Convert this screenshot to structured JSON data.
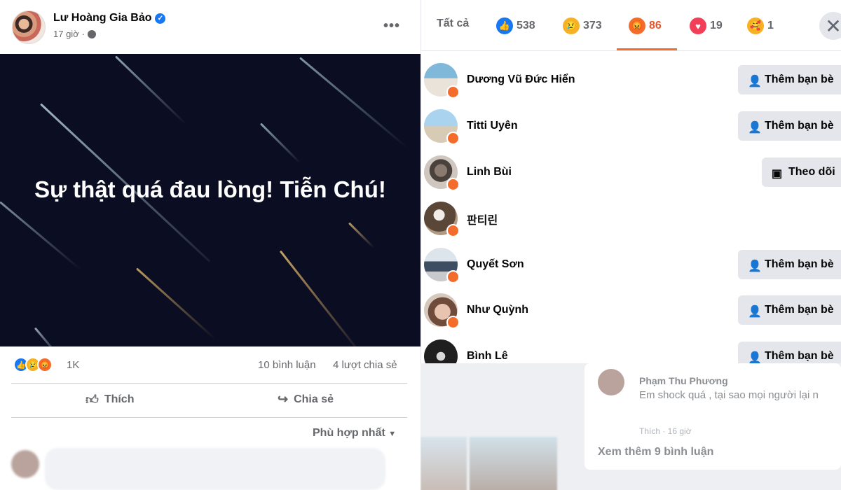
{
  "post": {
    "author": "Lư Hoàng Gia Bảo",
    "time": "17 giờ",
    "image_text": "Sự thật quá đau lòng! Tiễn Chú!",
    "reaction_count": "1K",
    "comments": "10 bình luận",
    "shares": "4 lượt chia sẻ",
    "like_label": "Thích",
    "share_label": "Chia sẻ",
    "sort_label": "Phù hợp nhất"
  },
  "dialog": {
    "tabs": [
      {
        "label": "Tất cả",
        "emoji": "none"
      },
      {
        "label": "538",
        "emoji": "like"
      },
      {
        "label": "373",
        "emoji": "sad"
      },
      {
        "label": "86",
        "emoji": "angry"
      },
      {
        "label": "19",
        "emoji": "love"
      },
      {
        "label": "1",
        "emoji": "care"
      }
    ],
    "active_tab": 3,
    "people": [
      {
        "name": "Dương Vũ Đức Hiển",
        "button": "Thêm bạn bè"
      },
      {
        "name": "Titti Uyên",
        "button": "Thêm bạn bè"
      },
      {
        "name": "Linh Bùi",
        "button": "Theo dõi"
      },
      {
        "name": "판티린",
        "button": ""
      },
      {
        "name": "Quyết Sơn",
        "button": "Thêm bạn bè"
      },
      {
        "name": "Như Quỳnh",
        "button": "Thêm bạn bè"
      },
      {
        "name": "Bình Lê",
        "button": "Thêm bạn bè"
      }
    ]
  },
  "background": {
    "commenter": "Phạm Thu Phương",
    "comment": "Em shock quá , tại sao mọi người lại n",
    "like_time": "Thích · 16 giờ",
    "more_comments": "Xem thêm 9 bình luận"
  },
  "colors": {
    "brand_blue": "#1877f2",
    "angry_orange": "#f36c2b",
    "text_secondary": "#65676b",
    "button_gray": "#e4e6eb"
  }
}
